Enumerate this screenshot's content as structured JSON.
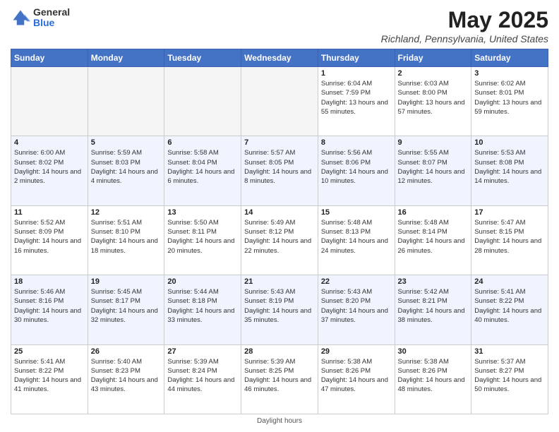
{
  "header": {
    "logo": {
      "general": "General",
      "blue": "Blue"
    },
    "title": "May 2025",
    "subtitle": "Richland, Pennsylvania, United States"
  },
  "days_of_week": [
    "Sunday",
    "Monday",
    "Tuesday",
    "Wednesday",
    "Thursday",
    "Friday",
    "Saturday"
  ],
  "weeks": [
    [
      {
        "day": "",
        "info": ""
      },
      {
        "day": "",
        "info": ""
      },
      {
        "day": "",
        "info": ""
      },
      {
        "day": "",
        "info": ""
      },
      {
        "day": "1",
        "info": "Sunrise: 6:04 AM\nSunset: 7:59 PM\nDaylight: 13 hours and 55 minutes."
      },
      {
        "day": "2",
        "info": "Sunrise: 6:03 AM\nSunset: 8:00 PM\nDaylight: 13 hours and 57 minutes."
      },
      {
        "day": "3",
        "info": "Sunrise: 6:02 AM\nSunset: 8:01 PM\nDaylight: 13 hours and 59 minutes."
      }
    ],
    [
      {
        "day": "4",
        "info": "Sunrise: 6:00 AM\nSunset: 8:02 PM\nDaylight: 14 hours and 2 minutes."
      },
      {
        "day": "5",
        "info": "Sunrise: 5:59 AM\nSunset: 8:03 PM\nDaylight: 14 hours and 4 minutes."
      },
      {
        "day": "6",
        "info": "Sunrise: 5:58 AM\nSunset: 8:04 PM\nDaylight: 14 hours and 6 minutes."
      },
      {
        "day": "7",
        "info": "Sunrise: 5:57 AM\nSunset: 8:05 PM\nDaylight: 14 hours and 8 minutes."
      },
      {
        "day": "8",
        "info": "Sunrise: 5:56 AM\nSunset: 8:06 PM\nDaylight: 14 hours and 10 minutes."
      },
      {
        "day": "9",
        "info": "Sunrise: 5:55 AM\nSunset: 8:07 PM\nDaylight: 14 hours and 12 minutes."
      },
      {
        "day": "10",
        "info": "Sunrise: 5:53 AM\nSunset: 8:08 PM\nDaylight: 14 hours and 14 minutes."
      }
    ],
    [
      {
        "day": "11",
        "info": "Sunrise: 5:52 AM\nSunset: 8:09 PM\nDaylight: 14 hours and 16 minutes."
      },
      {
        "day": "12",
        "info": "Sunrise: 5:51 AM\nSunset: 8:10 PM\nDaylight: 14 hours and 18 minutes."
      },
      {
        "day": "13",
        "info": "Sunrise: 5:50 AM\nSunset: 8:11 PM\nDaylight: 14 hours and 20 minutes."
      },
      {
        "day": "14",
        "info": "Sunrise: 5:49 AM\nSunset: 8:12 PM\nDaylight: 14 hours and 22 minutes."
      },
      {
        "day": "15",
        "info": "Sunrise: 5:48 AM\nSunset: 8:13 PM\nDaylight: 14 hours and 24 minutes."
      },
      {
        "day": "16",
        "info": "Sunrise: 5:48 AM\nSunset: 8:14 PM\nDaylight: 14 hours and 26 minutes."
      },
      {
        "day": "17",
        "info": "Sunrise: 5:47 AM\nSunset: 8:15 PM\nDaylight: 14 hours and 28 minutes."
      }
    ],
    [
      {
        "day": "18",
        "info": "Sunrise: 5:46 AM\nSunset: 8:16 PM\nDaylight: 14 hours and 30 minutes."
      },
      {
        "day": "19",
        "info": "Sunrise: 5:45 AM\nSunset: 8:17 PM\nDaylight: 14 hours and 32 minutes."
      },
      {
        "day": "20",
        "info": "Sunrise: 5:44 AM\nSunset: 8:18 PM\nDaylight: 14 hours and 33 minutes."
      },
      {
        "day": "21",
        "info": "Sunrise: 5:43 AM\nSunset: 8:19 PM\nDaylight: 14 hours and 35 minutes."
      },
      {
        "day": "22",
        "info": "Sunrise: 5:43 AM\nSunset: 8:20 PM\nDaylight: 14 hours and 37 minutes."
      },
      {
        "day": "23",
        "info": "Sunrise: 5:42 AM\nSunset: 8:21 PM\nDaylight: 14 hours and 38 minutes."
      },
      {
        "day": "24",
        "info": "Sunrise: 5:41 AM\nSunset: 8:22 PM\nDaylight: 14 hours and 40 minutes."
      }
    ],
    [
      {
        "day": "25",
        "info": "Sunrise: 5:41 AM\nSunset: 8:22 PM\nDaylight: 14 hours and 41 minutes."
      },
      {
        "day": "26",
        "info": "Sunrise: 5:40 AM\nSunset: 8:23 PM\nDaylight: 14 hours and 43 minutes."
      },
      {
        "day": "27",
        "info": "Sunrise: 5:39 AM\nSunset: 8:24 PM\nDaylight: 14 hours and 44 minutes."
      },
      {
        "day": "28",
        "info": "Sunrise: 5:39 AM\nSunset: 8:25 PM\nDaylight: 14 hours and 46 minutes."
      },
      {
        "day": "29",
        "info": "Sunrise: 5:38 AM\nSunset: 8:26 PM\nDaylight: 14 hours and 47 minutes."
      },
      {
        "day": "30",
        "info": "Sunrise: 5:38 AM\nSunset: 8:26 PM\nDaylight: 14 hours and 48 minutes."
      },
      {
        "day": "31",
        "info": "Sunrise: 5:37 AM\nSunset: 8:27 PM\nDaylight: 14 hours and 50 minutes."
      }
    ]
  ],
  "footer": "Daylight hours"
}
